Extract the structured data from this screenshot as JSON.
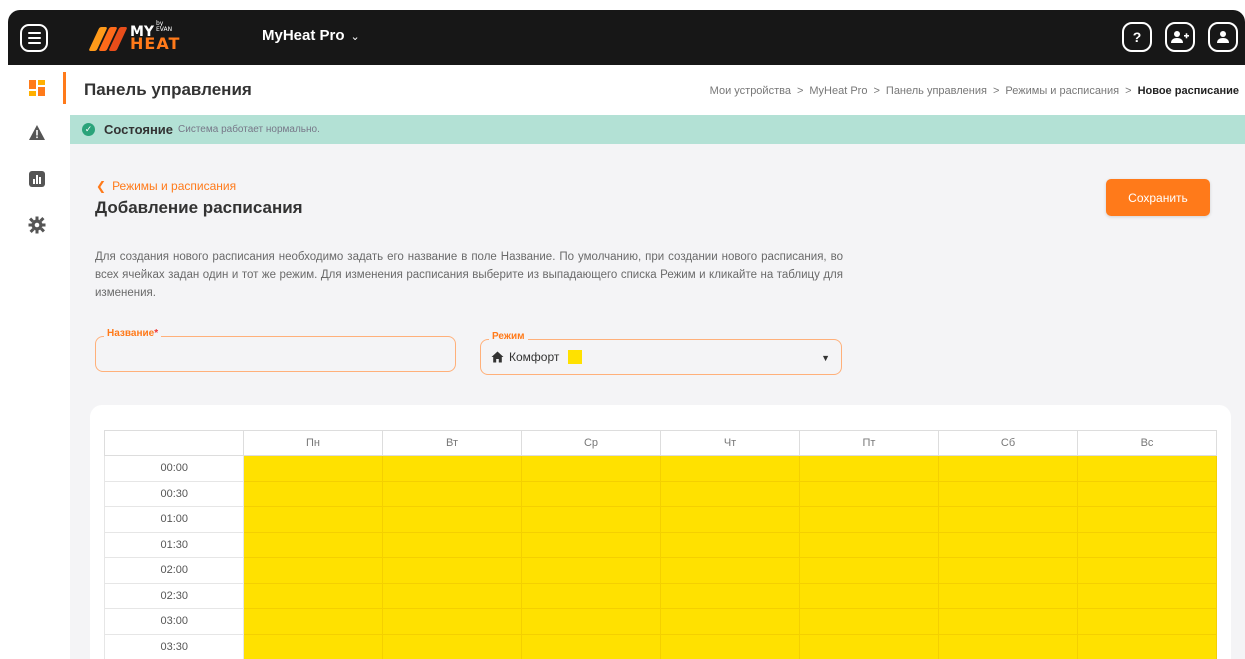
{
  "topbar": {
    "logo_text": "MY",
    "logo_heat": "HEAT",
    "logo_by": "by EVAN",
    "device_name": "MyHeat Pro",
    "help_label": "?"
  },
  "header": {
    "page_title": "Панель управления",
    "breadcrumb": [
      "Мои устройства",
      "MyHeat Pro",
      "Панель управления",
      "Режимы и расписания"
    ],
    "breadcrumb_current": "Новое расписание"
  },
  "status": {
    "label": "Состояние",
    "text": "Система работает нормально."
  },
  "form": {
    "back_link": "Режимы и расписания",
    "title": "Добавление расписания",
    "save_label": "Сохранить",
    "description": "Для создания нового расписания необходимо задать его название в поле Название. По умолчанию, при создании нового расписания, во всех ячейках задан один и тот же режим. Для изменения расписания выберите из выпадающего списка Режим и кликайте на таблицу для изменения.",
    "name_label": "Название",
    "name_required": "*",
    "name_value": "",
    "mode_label": "Режим",
    "mode_value": "Комфорт",
    "mode_color": "#ffe100"
  },
  "schedule": {
    "days": [
      "Пн",
      "Вт",
      "Ср",
      "Чт",
      "Пт",
      "Сб",
      "Вс"
    ],
    "times": [
      "00:00",
      "00:30",
      "01:00",
      "01:30",
      "02:00",
      "02:30",
      "03:00",
      "03:30"
    ],
    "cell_mode": "Комфорт"
  },
  "colors": {
    "accent": "#ff7a1a",
    "status_bg": "#b3e1d5",
    "comfort": "#ffe100",
    "topbar": "#171717"
  },
  "icons": {
    "menu": "menu-icon",
    "help": "help-icon",
    "add_user": "add-user-icon",
    "user": "user-icon",
    "dashboard": "dashboard-icon",
    "warning": "warning-icon",
    "stats": "stats-icon",
    "settings": "gear-icon",
    "home": "home-icon"
  }
}
